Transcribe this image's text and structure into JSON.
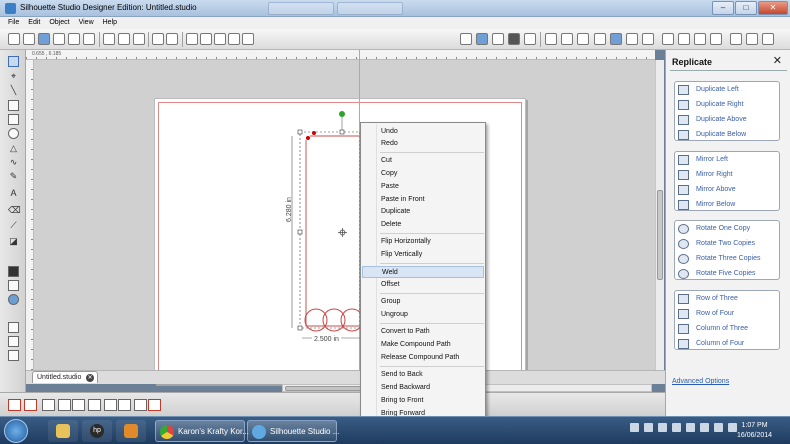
{
  "window": {
    "title": "Silhouette Studio Designer Edition: Untitled.studio",
    "controls": {
      "minimize": "–",
      "maximize": "□",
      "close": "✕"
    }
  },
  "menubar": [
    "File",
    "Edit",
    "Object",
    "View",
    "Help"
  ],
  "ruler": {
    "readout": "0.655 , 6.185"
  },
  "document": {
    "tab_label": "Untitled.studio",
    "width_dimension": "2.500 in",
    "height_dimension": "6.280 in"
  },
  "context_menu": {
    "items": [
      {
        "label": "Undo"
      },
      {
        "label": "Redo"
      },
      {
        "label": "Cut"
      },
      {
        "label": "Copy"
      },
      {
        "label": "Paste"
      },
      {
        "label": "Paste in Front"
      },
      {
        "label": "Duplicate"
      },
      {
        "label": "Delete"
      },
      {
        "label": "Flip Horizontally"
      },
      {
        "label": "Flip Vertically"
      },
      {
        "label": "Weld",
        "highlighted": true
      },
      {
        "label": "Offset"
      },
      {
        "label": "Group"
      },
      {
        "label": "Ungroup"
      },
      {
        "label": "Convert to Path"
      },
      {
        "label": "Make Compound Path"
      },
      {
        "label": "Release Compound Path"
      },
      {
        "label": "Send to Back"
      },
      {
        "label": "Send Backward"
      },
      {
        "label": "Bring to Front"
      },
      {
        "label": "Bring Forward"
      }
    ]
  },
  "replicate_panel": {
    "title": "Replicate",
    "close": "✕",
    "groups": [
      [
        "Duplicate Left",
        "Duplicate Right",
        "Duplicate Above",
        "Duplicate Below"
      ],
      [
        "Mirror Left",
        "Mirror Right",
        "Mirror Above",
        "Mirror Below"
      ],
      [
        "Rotate One Copy",
        "Rotate Two Copies",
        "Rotate Three Copies",
        "Rotate Five Copies"
      ],
      [
        "Row of Three",
        "Row of Four",
        "Column of Three",
        "Column of Four"
      ]
    ],
    "advanced_link": "Advanced Options"
  },
  "taskbar": {
    "tasks": [
      {
        "label": "Karon's Krafty Kor..."
      },
      {
        "label": "Silhouette Studio ..."
      }
    ],
    "pinned_hp_label": "hp",
    "clock": {
      "time": "1:07 PM",
      "date": "16/06/2014"
    }
  },
  "colors": {
    "selection_highlight": "#d9e5f4",
    "cut_line": "#c0392b",
    "link": "#3a5fa6",
    "taskbar": "#1e3b5e"
  }
}
